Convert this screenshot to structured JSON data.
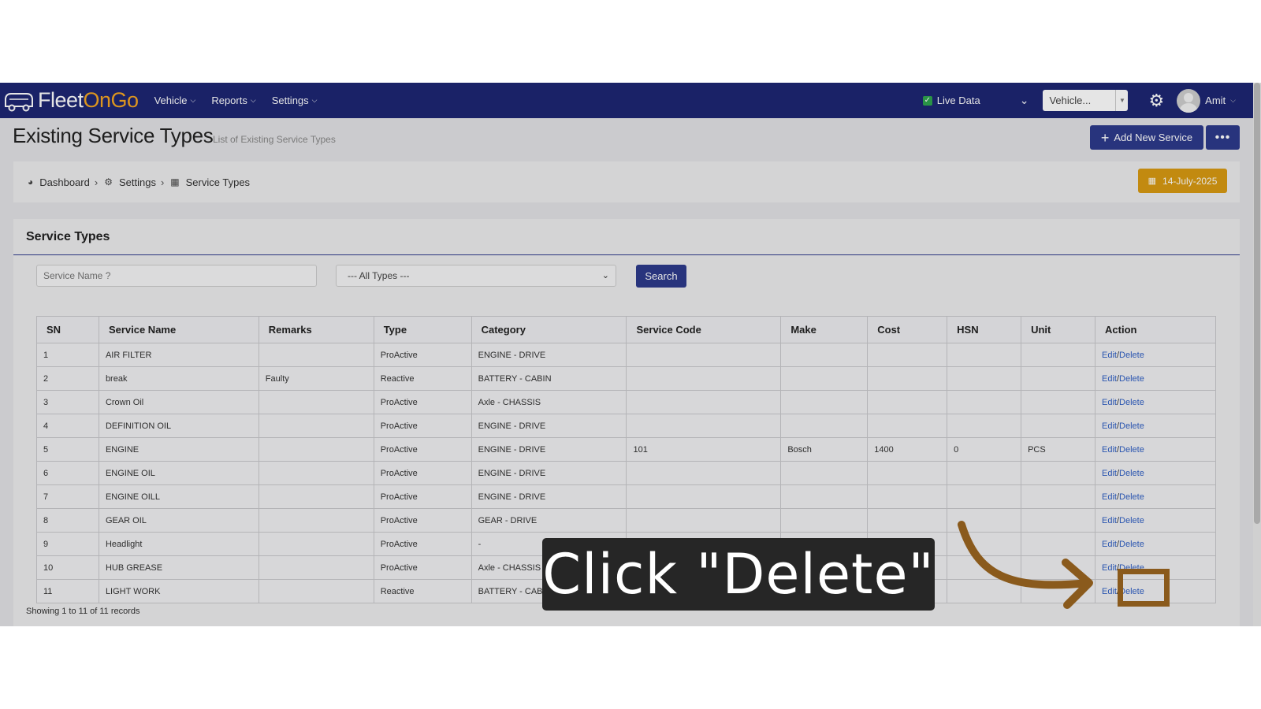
{
  "app": {
    "brand_part1": "Fleet",
    "brand_part2": "OnGo",
    "nav": [
      {
        "label": "Vehicle"
      },
      {
        "label": "Reports"
      },
      {
        "label": "Settings"
      }
    ],
    "live_data_label": "Live Data",
    "vehicle_select_value": "Vehicle...",
    "user_name": "Amit"
  },
  "header": {
    "title": "Existing Service Types",
    "subtitle": "List of Existing Service Types",
    "add_button": "Add New Service",
    "more_button": "•••"
  },
  "breadcrumb": [
    {
      "label": "Dashboard",
      "icon": "dashboard-icon"
    },
    {
      "label": "Settings",
      "icon": "cogs-icon"
    },
    {
      "label": "Service Types",
      "icon": "calendar-icon"
    }
  ],
  "date_button": "14-July-2025",
  "card": {
    "title": "Service Types",
    "search_placeholder": "Service Name ?",
    "type_filter_value": "--- All Types ---",
    "search_button": "Search",
    "footer": "Showing 1 to 11 of 11 records"
  },
  "table": {
    "columns": [
      "SN",
      "Service Name",
      "Remarks",
      "Type",
      "Category",
      "Service Code",
      "Make",
      "Cost",
      "HSN",
      "Unit",
      "Action"
    ],
    "edit_label": "Edit",
    "delete_label": "Delete",
    "rows": [
      {
        "sn": "1",
        "name": "AIR FILTER",
        "remarks": "",
        "type": "ProActive",
        "category": "ENGINE - DRIVE",
        "code": "",
        "make": "",
        "cost": "",
        "hsn": "",
        "unit": ""
      },
      {
        "sn": "2",
        "name": "break",
        "remarks": "Faulty",
        "type": "Reactive",
        "category": "BATTERY - CABIN",
        "code": "",
        "make": "",
        "cost": "",
        "hsn": "",
        "unit": ""
      },
      {
        "sn": "3",
        "name": "Crown Oil",
        "remarks": "",
        "type": "ProActive",
        "category": "Axle - CHASSIS",
        "code": "",
        "make": "",
        "cost": "",
        "hsn": "",
        "unit": ""
      },
      {
        "sn": "4",
        "name": "DEFINITION OIL",
        "remarks": "",
        "type": "ProActive",
        "category": "ENGINE - DRIVE",
        "code": "",
        "make": "",
        "cost": "",
        "hsn": "",
        "unit": ""
      },
      {
        "sn": "5",
        "name": "ENGINE",
        "remarks": "",
        "type": "ProActive",
        "category": "ENGINE - DRIVE",
        "code": "101",
        "make": "Bosch",
        "cost": "1400",
        "hsn": "0",
        "unit": "PCS"
      },
      {
        "sn": "6",
        "name": "ENGINE OIL",
        "remarks": "",
        "type": "ProActive",
        "category": "ENGINE - DRIVE",
        "code": "",
        "make": "",
        "cost": "",
        "hsn": "",
        "unit": ""
      },
      {
        "sn": "7",
        "name": "ENGINE OILL",
        "remarks": "",
        "type": "ProActive",
        "category": "ENGINE - DRIVE",
        "code": "",
        "make": "",
        "cost": "",
        "hsn": "",
        "unit": ""
      },
      {
        "sn": "8",
        "name": "GEAR OIL",
        "remarks": "",
        "type": "ProActive",
        "category": "GEAR - DRIVE",
        "code": "",
        "make": "",
        "cost": "",
        "hsn": "",
        "unit": ""
      },
      {
        "sn": "9",
        "name": "Headlight",
        "remarks": "",
        "type": "ProActive",
        "category": "-",
        "code": "",
        "make": "",
        "cost": "",
        "hsn": "",
        "unit": ""
      },
      {
        "sn": "10",
        "name": "HUB GREASE",
        "remarks": "",
        "type": "ProActive",
        "category": "Axle - CHASSIS",
        "code": "",
        "make": "",
        "cost": "",
        "hsn": "",
        "unit": ""
      },
      {
        "sn": "11",
        "name": "LIGHT WORK",
        "remarks": "",
        "type": "Reactive",
        "category": "BATTERY - CABIN",
        "code": "",
        "make": "",
        "cost": "",
        "hsn": "",
        "unit": ""
      }
    ]
  },
  "overlay": {
    "callout_text": "Click \"Delete\"",
    "arrow_color": "#8a5a1c"
  },
  "colors": {
    "nav_bg": "#1d2673",
    "primary": "#2d3a8c",
    "date_button": "#d89a12",
    "link": "#2f5fc4"
  }
}
